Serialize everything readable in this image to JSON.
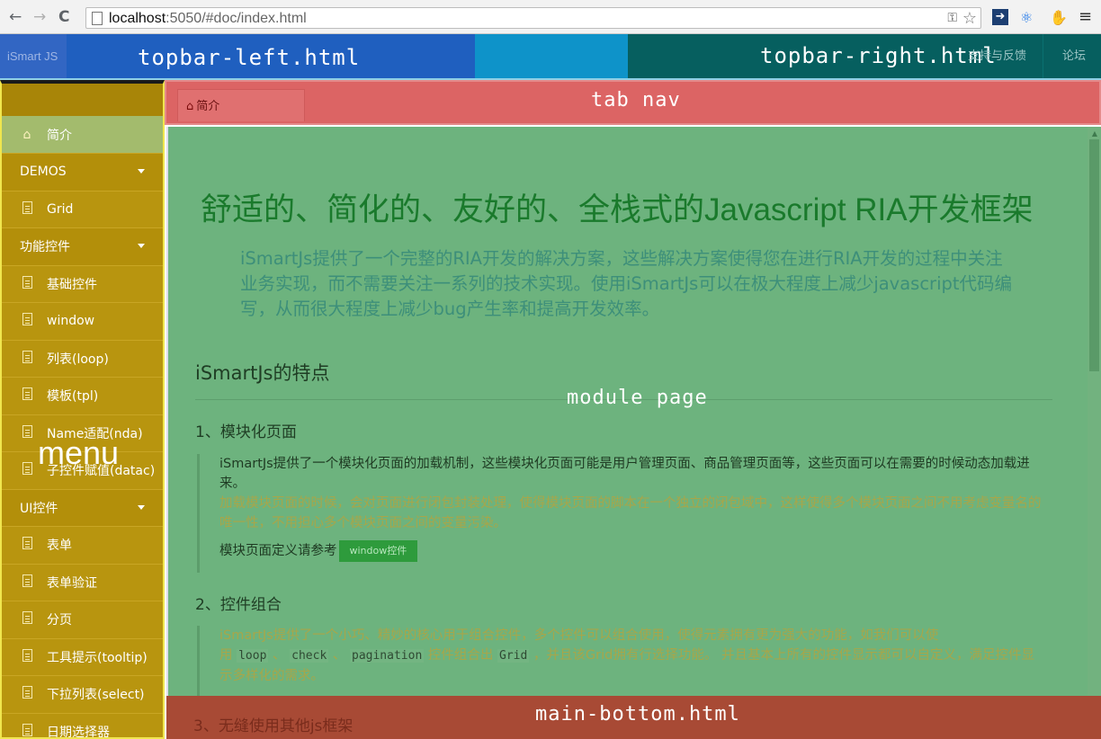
{
  "browser": {
    "url_host": "localhost",
    "url_rest": ":5050/#doc/index.html"
  },
  "topbar": {
    "brand": "iSmart JS",
    "left_label": "topbar-left.html",
    "right_label": "topbar-right.html",
    "support": "支持与反馈",
    "forum": "论坛"
  },
  "sidebar": {
    "overlay_label": "menu",
    "home": "简介",
    "groups": [
      "DEMOS",
      "功能控件",
      "UI控件"
    ],
    "items": [
      "Grid",
      "基础控件",
      "window",
      "列表(loop)",
      "模板(tpl)",
      "Name适配(nda)",
      "子控件赋值(datac)",
      "表单",
      "表单验证",
      "分页",
      "工具提示(tooltip)",
      "下拉列表(select)",
      "日期选择器"
    ]
  },
  "tabnav": {
    "tab_label": "简介",
    "overlay_label": "tab nav"
  },
  "module": {
    "overlay_label": "module page",
    "title": "舒适的、简化的、友好的、全栈式的Javascript RIA开发框架",
    "intro": "iSmartJs提供了一个完整的RIA开发的解决方案，这些解决方案使得您在进行RIA开发的过程中关注业务实现，而不需要关注一系列的技术实现。使用iSmartJs可以在极大程度上减少javascript代码编写，从而很大程度上减少bug产生率和提高开发效率。",
    "features_heading": "iSmartJs的特点",
    "s1_heading": "1、模块化页面",
    "s1_p1": "iSmartJs提供了一个模块化页面的加载机制，这些模块化页面可能是用户管理页面、商品管理页面等，这些页面可以在需要的时候动态加载进来。",
    "s1_p2": "加载模块页面的时候，会对页面进行闭包封装处理，使得模块页面的脚本在一个独立的闭包域中，这样使得多个模块页面之间不用考虑变量名的唯一性，不用担心多个模块页面之间的变量污染。",
    "s1_ref": "模块页面定义请参考",
    "s1_button": "window控件",
    "s2_heading": "2、控件组合",
    "s2_p1": "iSmartJs提供了一个小巧、精妙的核心用于组合控件，多个控件可以组合使用，使得元素拥有更为强大的功能，如我们可以使",
    "s2_use": "用",
    "s2_code1": "loop",
    "s2_sep1": "、",
    "s2_code2": "check",
    "s2_sep2": "、",
    "s2_code3": "pagination",
    "s2_mid": "控件组合出",
    "s2_code4": "Grid",
    "s2_p2": "，并且该Grid拥有行选择功能。 并且基本上所有的控件显示都可以自定义，满足控件显示多样化的需求。",
    "s3_heading": "3、无缝使用其他js框架"
  },
  "mainbottom": {
    "overlay_label": "main-bottom.html"
  },
  "colors": {
    "topbar_left": "#1f5fbf",
    "topbar_mid": "#0e93c9",
    "topbar_right": "#065f5f",
    "sidebar": "#b8950f",
    "tabnav": "#dc6464",
    "module": "#6db37e",
    "mainbottom": "#a84a35"
  }
}
